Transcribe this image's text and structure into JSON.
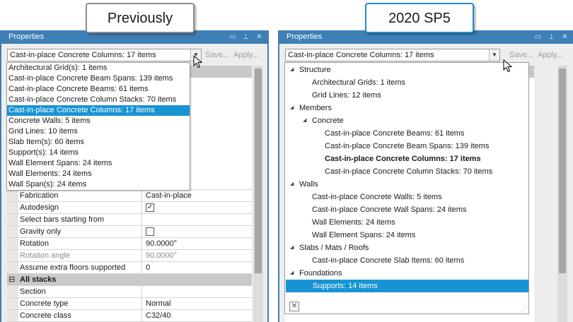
{
  "callouts": {
    "previous": "Previously",
    "new": "2020 SP5"
  },
  "colors": {
    "titlebar": "#3e7fb5",
    "selection": "#1994d3",
    "callout_new_border": "#1e8ec9"
  },
  "left": {
    "title": "Properties",
    "combo_value": "Cast-in-place Concrete Columns: 17 items",
    "save_label": "Save...",
    "apply_label": "Apply...",
    "dropdown_items": [
      "Architectural Grid(s): 1 items",
      "Cast-in-place Concrete Beam Spans: 139 items",
      "Cast-in-place Concrete Beams: 61 items",
      "Cast-in-place Concrete Column Stacks: 70 items",
      "Cast-in-place Concrete Columns: 17 items",
      "Concrete Walls: 5 items",
      "Grid Lines: 10 items",
      "Slab Item(s): 60 items",
      "Support(s): 14 items",
      "Wall Element Spans: 24 items",
      "Wall Elements: 24 items",
      "Wall Span(s): 24 items"
    ],
    "props": [
      {
        "label": "Fabrication",
        "value": "Cast-in-place"
      },
      {
        "label": "Autodesign",
        "value": "✓"
      },
      {
        "label": "Select bars starting from",
        "value": ""
      },
      {
        "label": "Gravity only",
        "value": ""
      },
      {
        "label": "Rotation",
        "value": "90.0000°"
      },
      {
        "label": "Rotation angle",
        "value": "90.0000°"
      },
      {
        "label": "Assume extra floors supported",
        "value": "0"
      },
      {
        "label": "All stacks",
        "value": ""
      },
      {
        "label": "Section",
        "value": ""
      },
      {
        "label": "Concrete type",
        "value": "Normal"
      },
      {
        "label": "Concrete class",
        "value": "C32/40"
      }
    ],
    "expander_symbol": "⊟"
  },
  "right": {
    "title": "Properties",
    "combo_value": "Cast-in-place Concrete Columns: 17 items",
    "save_label": "Save...",
    "apply_label": "Apply...",
    "tree": [
      "Structure",
      "Architectural Grids: 1 items",
      "Grid Lines: 12 items",
      "Members",
      "Concrete",
      "Cast-in-place Concrete Beams: 61 items",
      "Cast-in-place Concrete Beam Spans: 139 items",
      "Cast-in-place Concrete Columns: 17 items",
      "Cast-in-place Concrete Column Stacks: 70 items",
      "Walls",
      "Cast-in-place Concrete Walls: 5 items",
      "Cast-in-place Concrete Wall Spans: 24 items",
      "Wall Elements: 24 items",
      "Wall Element Spans: 24 items",
      "Slabs / Mats / Roofs",
      "Cast-in-place Concrete Slab Items: 60 items",
      "Foundations",
      "Supports: 14 items"
    ],
    "clear_symbol": "✕"
  },
  "icons": {
    "title_buttons": [
      "restore-icon",
      "pin-icon",
      "close-icon"
    ],
    "caret": "collapse-caret-icon"
  }
}
